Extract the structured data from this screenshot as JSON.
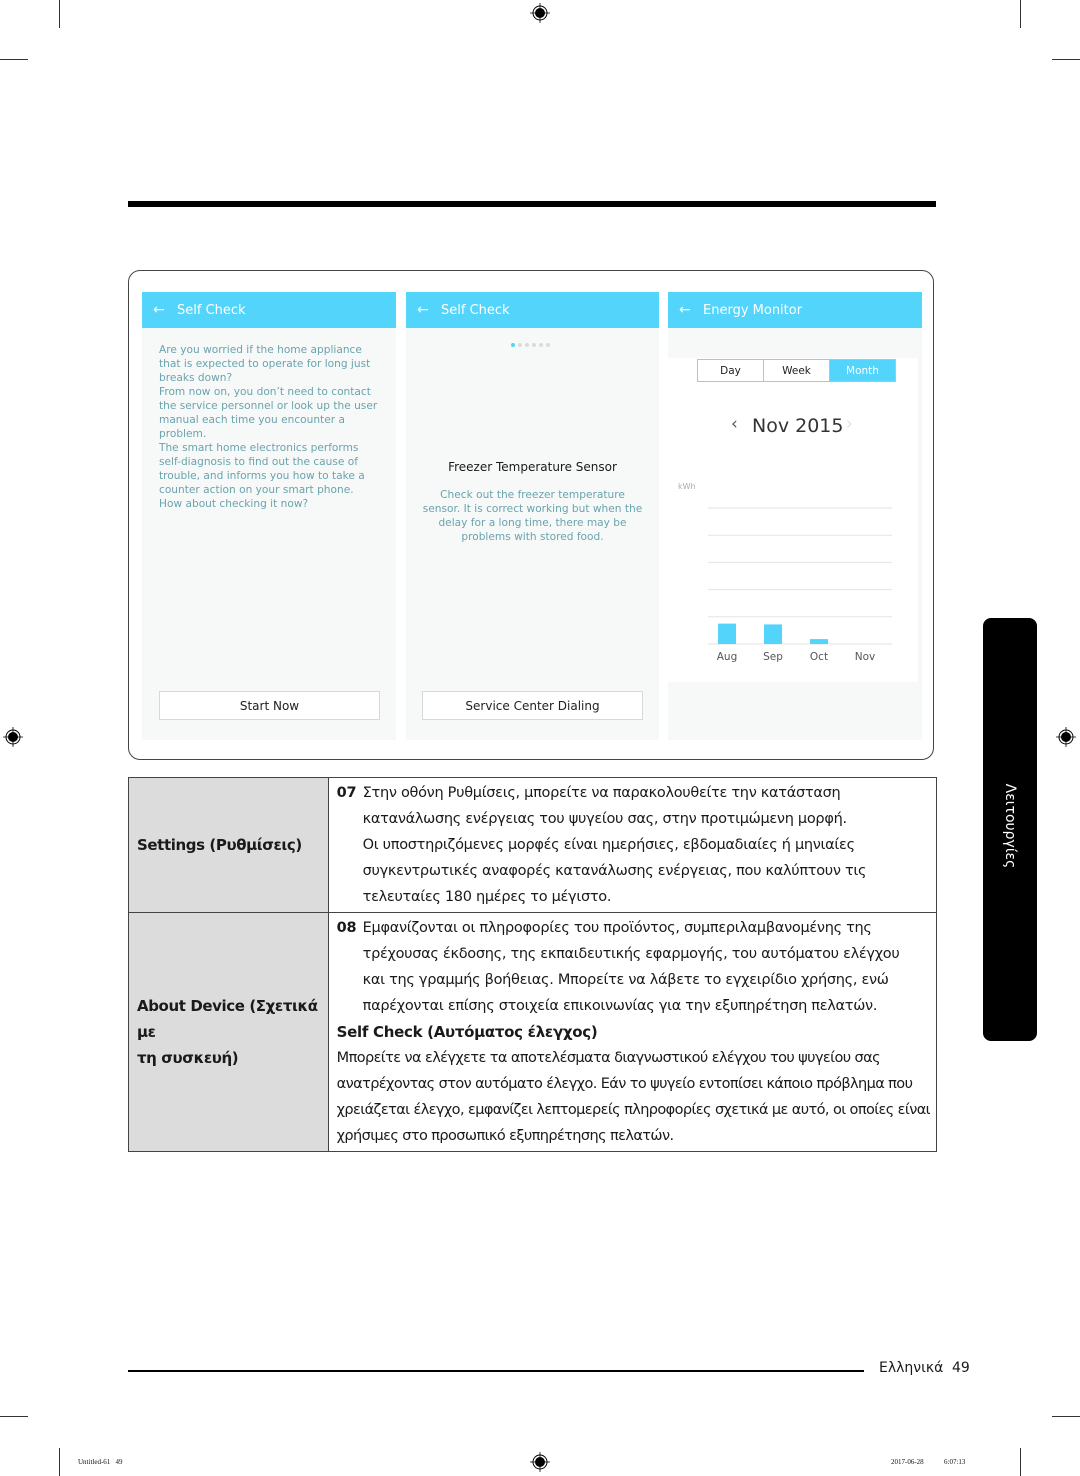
{
  "screens": [
    {
      "title": "Self Check",
      "back_icon": "arrow-left",
      "body": [
        "Are you worried if the home appliance",
        "that is expected to operate for long just",
        "breaks down?",
        "From now on, you don’t need to contact",
        "the service personnel or look up the user",
        "manual each time you encounter a",
        "problem.",
        "The smart home electronics performs",
        "self-diagnosis to find out the cause of",
        "trouble, and informs you how to take a",
        "counter action on your smart phone.",
        "How about checking it now?"
      ],
      "button": "Start Now"
    },
    {
      "title": "Self Check",
      "back_icon": "arrow-left",
      "pager": {
        "total": 6,
        "active": 1
      },
      "heading": "Freezer Temperature Sensor",
      "body": [
        "Check out the freezer temperature",
        "sensor. It is correct working but when the",
        "delay for a long time, there may be",
        "problems with stored food."
      ],
      "button": "Service Center Dialing"
    },
    {
      "title": "Energy Monitor",
      "back_icon": "arrow-left",
      "segments": [
        {
          "label": "Day",
          "selected": false
        },
        {
          "label": "Week",
          "selected": false
        },
        {
          "label": "Month",
          "selected": true
        }
      ],
      "period": "Nov 2015",
      "prev_icon": "chevron-left",
      "next_icon": "chevron-right"
    }
  ],
  "chart_data": {
    "type": "bar",
    "title": "",
    "ylabel": "kWh",
    "xlabel": "",
    "categories": [
      "Aug",
      "Sep",
      "Oct",
      "Nov"
    ],
    "values": [
      0.75,
      0.72,
      0.18,
      0
    ],
    "ylim": [
      0,
      5
    ],
    "grid": true,
    "accent_color": "#53d4fb"
  },
  "table": {
    "rows": [
      {
        "label": "Settings (Ρυθμίσεις)",
        "number": "07",
        "lines": [
          "Στην οθόνη Ρυθμίσεις, μπορείτε να παρακολουθείτε την κατάσταση",
          "κατανάλωσης ενέργειας του ψυγείου σας, στην προτιμώμενη μορφή.",
          "Οι υποστηριζόμενες μορφές είναι ημερήσιες, εβδομαδιαίες ή μηνιαίες",
          "συγκεντρωτικές αναφορές κατανάλωσης ενέργειας, που καλύπτουν τις",
          "τελευταίες 180 ημέρες το μέγιστο."
        ]
      },
      {
        "label_lines": [
          "About Device (Σχετικά με",
          "τη συσκευή)"
        ],
        "number": "08",
        "lines": [
          "Εμφανίζονται οι πληροφορίες του προϊόντος, συμπεριλαμβανομένης της",
          "τρέχουσας έκδοσης, της εκπαιδευτικής εφαρμογής, του αυτόματου ελέγχου",
          "και της γραμμής βοήθειας. Μπορείτε να λάβετε το εγχειρίδιο χρήσης, ενώ",
          "παρέχονται επίσης στοιχεία επικοινωνίας για την εξυπηρέτηση πελατών."
        ],
        "subheading": "Self Check (Αυτόματος έλεγχος)",
        "sub_lines": [
          "Μπορείτε να ελέγχετε τα αποτελέσματα διαγνωστικού ελέγχου του ψυγείου σας",
          "ανατρέχοντας στον αυτόματο έλεγχο. Εάν το ψυγείο εντοπίσει κάποιο πρόβλημα που",
          "χρειάζεται έλεγχο, εμφανίζει λεπτομερείς πληροφορίες σχετικά με αυτό, οι οποίες είναι",
          "χρήσιμες στο προσωπικό εξυπηρέτησης πελατών."
        ]
      }
    ]
  },
  "side_tab": "Λειτουργίες",
  "footer": {
    "language": "Ελληνικά",
    "page": "49"
  },
  "print_meta": {
    "file": "Untitled-61   49",
    "date": "2017-06-28",
    "time": "6:07:13"
  }
}
